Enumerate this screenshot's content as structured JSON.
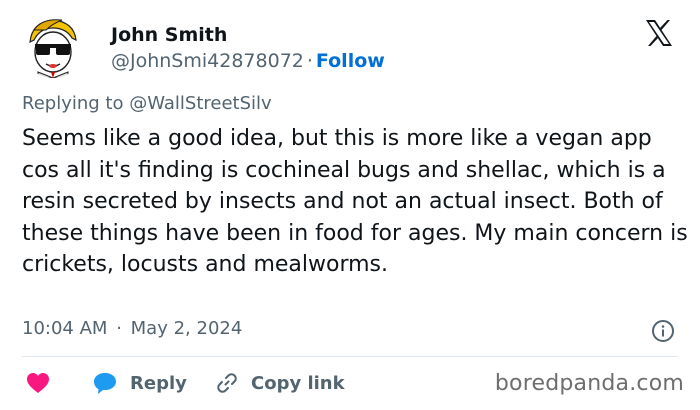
{
  "author": {
    "name": "John Smith",
    "handle": "@JohnSmi42878072",
    "separator": "·",
    "follow_label": "Follow",
    "avatar_icon": "wallstreet-guy-avatar"
  },
  "platform_icon": "x-logo-icon",
  "reply": {
    "prefix": "Replying to",
    "mention": "@WallStreetSilv"
  },
  "tweet": {
    "text": "Seems like a good idea, but this is more like a vegan app cos all it's finding is cochineal bugs and shellac, which is a resin secreted by insects and not an actual insect. Both of these things have been in food for ages. My main concern is crickets, locusts and mealworms."
  },
  "meta": {
    "time": "10:04 AM",
    "separator": "·",
    "date": "May 2, 2024",
    "info_icon": "info-icon"
  },
  "actions": {
    "like_icon": "heart-icon",
    "reply_label": "Reply",
    "copy_label": "Copy link"
  },
  "watermark": "boredpanda.com",
  "colors": {
    "text": "#0f1419",
    "secondary": "#536471",
    "follow": "#006fd6",
    "like": "#f91880",
    "reply_bubble": "#1d9bf0"
  }
}
